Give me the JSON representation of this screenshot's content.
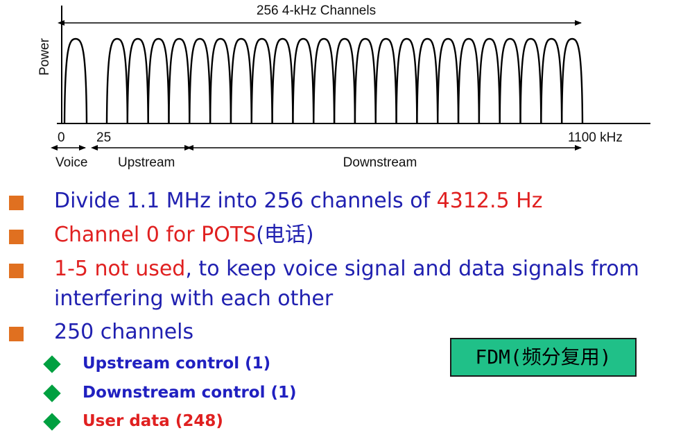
{
  "diagram": {
    "title": "256 4-kHz Channels",
    "y_axis_label": "Power",
    "tick_labels": {
      "zero": "0",
      "twenty_five": "25",
      "end": "1100 kHz"
    },
    "bands": {
      "voice": "Voice",
      "upstream": "Upstream",
      "downstream": "Downstream"
    },
    "num_channel_humps": 24,
    "line_color": "#000000"
  },
  "bullets": [
    {
      "segments": [
        {
          "text": "Divide 1.1 MHz into 256 channels of ",
          "color": "#2020b0"
        },
        {
          "text": "4312.5 Hz",
          "color": "#e02020"
        }
      ]
    },
    {
      "segments": [
        {
          "text": "Channel 0 for POTS",
          "color": "#e02020"
        },
        {
          "text": "(电话)",
          "color": "#2020b0"
        }
      ]
    },
    {
      "segments": [
        {
          "text": "1-5 not used",
          "color": "#e02020"
        },
        {
          "text": ", to keep voice signal and data signals from",
          "color": "#2020b0"
        }
      ]
    },
    {
      "segments": [
        {
          "text": "interfering with each other",
          "color": "#2020b0"
        }
      ],
      "continuation": true
    },
    {
      "segments": [
        {
          "text": "250 channels",
          "color": "#2020b0"
        }
      ]
    }
  ],
  "sub_bullets": [
    {
      "text": "Upstream control (1)",
      "color": "#2020c0"
    },
    {
      "text": "Downstream control (1)",
      "color": "#2020c0"
    },
    {
      "text": "User data (248)",
      "color": "#e02020"
    }
  ],
  "fdm_label": "FDM(频分复用)",
  "colors": {
    "bullet_square": "#e07020",
    "sub_bullet_diamond": "#00a040",
    "fdm_box_bg": "#20c088",
    "fdm_box_border": "#1a1a1a"
  }
}
